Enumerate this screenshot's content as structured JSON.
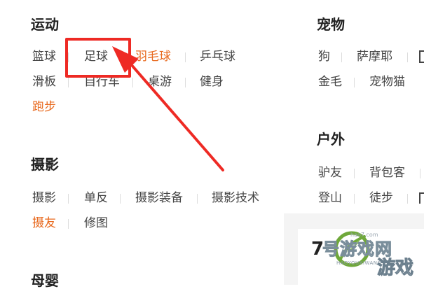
{
  "sections": {
    "sports": {
      "title": "运动",
      "tags": [
        "篮球",
        "足球",
        "羽毛球",
        "乒乓球",
        "滑板",
        "自行车",
        "桌游",
        "健身",
        "跑步"
      ]
    },
    "pets": {
      "title": "宠物",
      "tags": [
        "狗",
        "萨摩耶",
        "金毛",
        "宠物猫"
      ]
    },
    "outdoor": {
      "title": "户外",
      "tags": [
        "驴友",
        "背包客",
        "登山",
        "徒步"
      ]
    },
    "photography": {
      "title": "摄影",
      "tags": [
        "摄影",
        "单反",
        "摄影装备",
        "摄影技术",
        "摄友",
        "修图"
      ]
    },
    "maternity": {
      "title": "母婴"
    }
  },
  "colors": {
    "hot_tag": "#e86a1f",
    "annotation_red": "#ee2a24"
  },
  "watermark": {
    "number": "7",
    "site_name": "号游戏网",
    "url": "hao7.com",
    "pinyin": "HAOYOUXIWANG",
    "game_text": "游戏"
  }
}
